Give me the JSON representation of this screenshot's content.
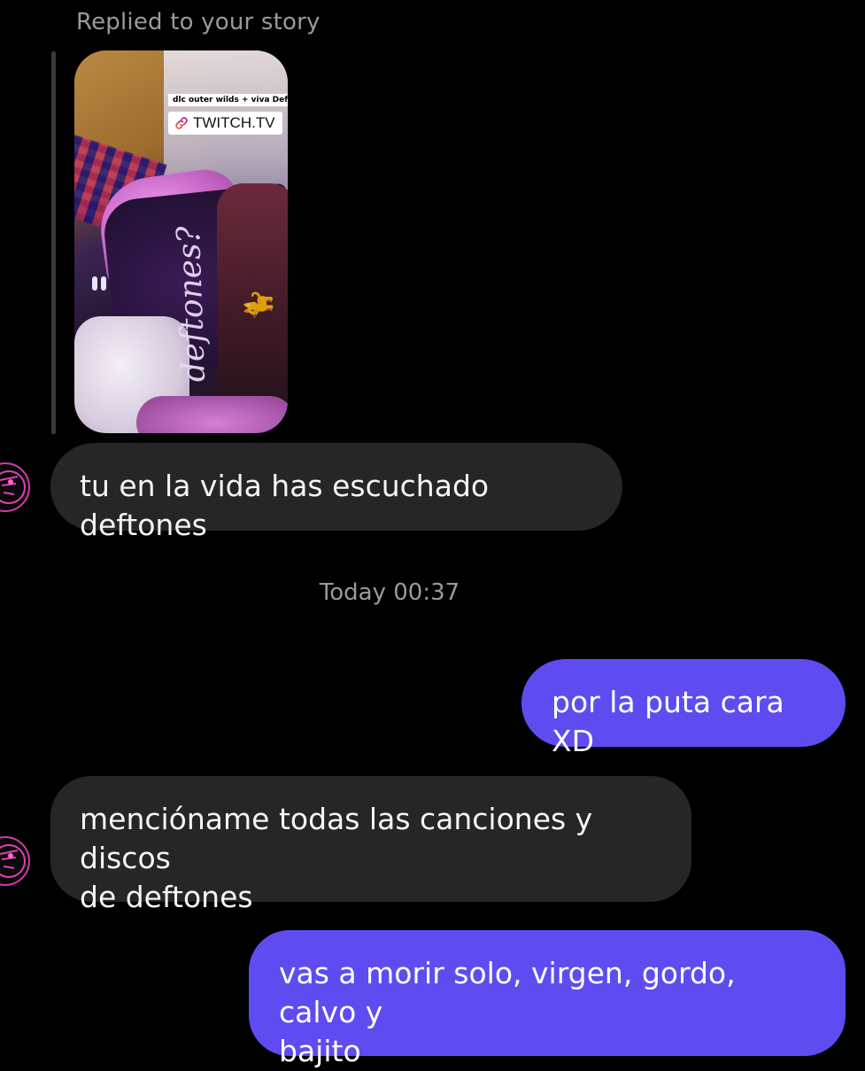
{
  "reply_header": "Replied to your story",
  "story": {
    "caption": "dlc outer wilds + viva Deftones",
    "link_label": "TWITCH.TV",
    "shirt_text": "deftones?"
  },
  "timestamp": "Today 00:37",
  "messages": [
    {
      "direction": "incoming",
      "lines": [
        "tu en la vida has escuchado deftones"
      ]
    },
    {
      "direction": "outgoing",
      "lines": [
        "por la puta cara XD"
      ]
    },
    {
      "direction": "incoming",
      "lines": [
        "menciónamе todas las canciones y discos",
        "de deftones"
      ]
    },
    {
      "direction": "outgoing",
      "lines": [
        "vas a morir solo, virgen, gordo, calvo y",
        "bajito"
      ]
    }
  ],
  "colors": {
    "background": "#000000",
    "incoming_bubble": "#262626",
    "outgoing_bubble": "#5f4cf1",
    "meta_text": "#9a9a9a",
    "avatar_accent": "#d13aa9"
  }
}
